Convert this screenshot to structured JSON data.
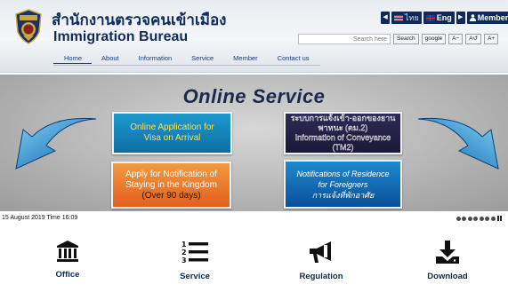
{
  "header": {
    "title_th": "สำนักงานตรวจคนเข้าเมือง",
    "title_en": "Immigration Bureau"
  },
  "lang_bar": {
    "thai_label": "ไทย",
    "eng_label": "Eng",
    "member_label": "Member"
  },
  "search": {
    "placeholder": "Search here",
    "search_button": "Search",
    "google_button": "google",
    "font_minus": "A−",
    "font_reset": "A↺",
    "font_plus": "A+"
  },
  "nav": {
    "items": [
      "Home",
      "About",
      "Information",
      "Service",
      "Member",
      "Contact us"
    ]
  },
  "banner": {
    "title": "Online Service",
    "tiles": [
      {
        "line1": "Online Application for",
        "line2": "Visa on Arrival"
      },
      {
        "line1": "Apply for Notification of",
        "line2": "Staying in the Kingdom",
        "line3": "(Over 90 days)"
      },
      {
        "line1": "ระบบการแจ้งเข้า-ออกของยานพาหนะ (ตม.2)",
        "line2": "Information of Conveyance",
        "line3": "(TM2)"
      },
      {
        "line1": "Notifications of Residence",
        "line2": "for Foreigners",
        "line3": "การแจ้งที่พักอาศัย"
      }
    ]
  },
  "status": {
    "date_text": "15 August 2019 Time 16:09"
  },
  "quick_links": [
    {
      "label": "Office",
      "icon": "building-icon"
    },
    {
      "label": "Service",
      "icon": "numbered-list-icon"
    },
    {
      "label": "Regulation",
      "icon": "megaphone-icon"
    },
    {
      "label": "Download",
      "icon": "download-icon"
    }
  ],
  "colors": {
    "brand_navy": "#0e2c5c",
    "header_bg": "#eef1f4",
    "banner_bg": "#bdbdbd"
  }
}
